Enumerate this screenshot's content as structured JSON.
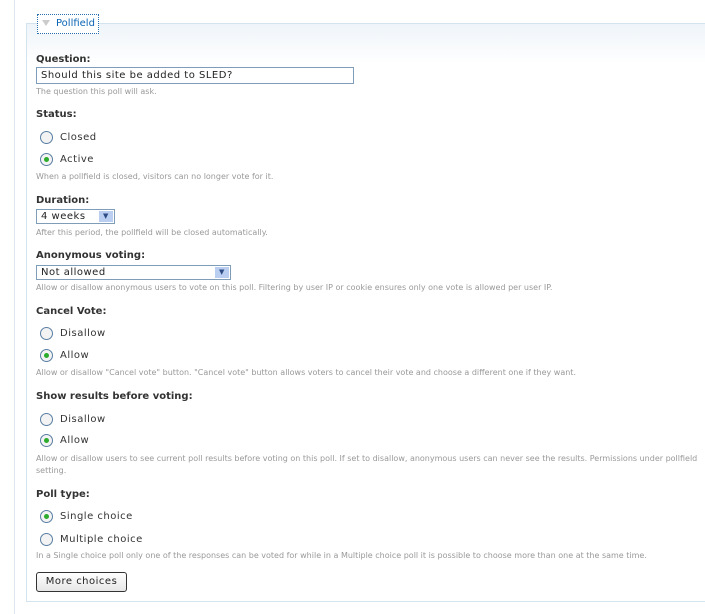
{
  "fieldset": {
    "legend": "Pollfield"
  },
  "question": {
    "label": "Question:",
    "value": "Should this site be added to SLED?",
    "hint": "The question this poll will ask."
  },
  "status": {
    "label": "Status:",
    "options": [
      "Closed",
      "Active"
    ],
    "selected": "Active",
    "hint": "When a pollfield is closed, visitors can no longer vote for it."
  },
  "duration": {
    "label": "Duration:",
    "value": "4 weeks",
    "hint": "After this period, the pollfield will be closed automatically."
  },
  "anonymous": {
    "label": "Anonymous voting:",
    "value": "Not allowed",
    "hint": "Allow or disallow anonymous users to vote on this poll. Filtering by user IP or cookie ensures only one vote is allowed per user IP."
  },
  "cancel_vote": {
    "label": "Cancel Vote:",
    "options": [
      "Disallow",
      "Allow"
    ],
    "selected": "Allow",
    "hint": "Allow or disallow \"Cancel vote\" button. \"Cancel vote\" button allows voters to cancel their vote and choose a different one if they want."
  },
  "show_results": {
    "label": "Show results before voting:",
    "options": [
      "Disallow",
      "Allow"
    ],
    "selected": "Allow",
    "hint": "Allow or disallow users to see current poll results before voting on this poll. If set to disallow, anonymous users can never see the results. Permissions under pollfield setting."
  },
  "poll_type": {
    "label": "Poll type:",
    "options": [
      "Single choice",
      "Multiple choice"
    ],
    "selected": "Single choice",
    "hint": "In a Single choice poll only one of the responses can be voted for while in a Multiple choice poll it is possible to choose more than one at the same time."
  },
  "more_choices_button": "More choices"
}
